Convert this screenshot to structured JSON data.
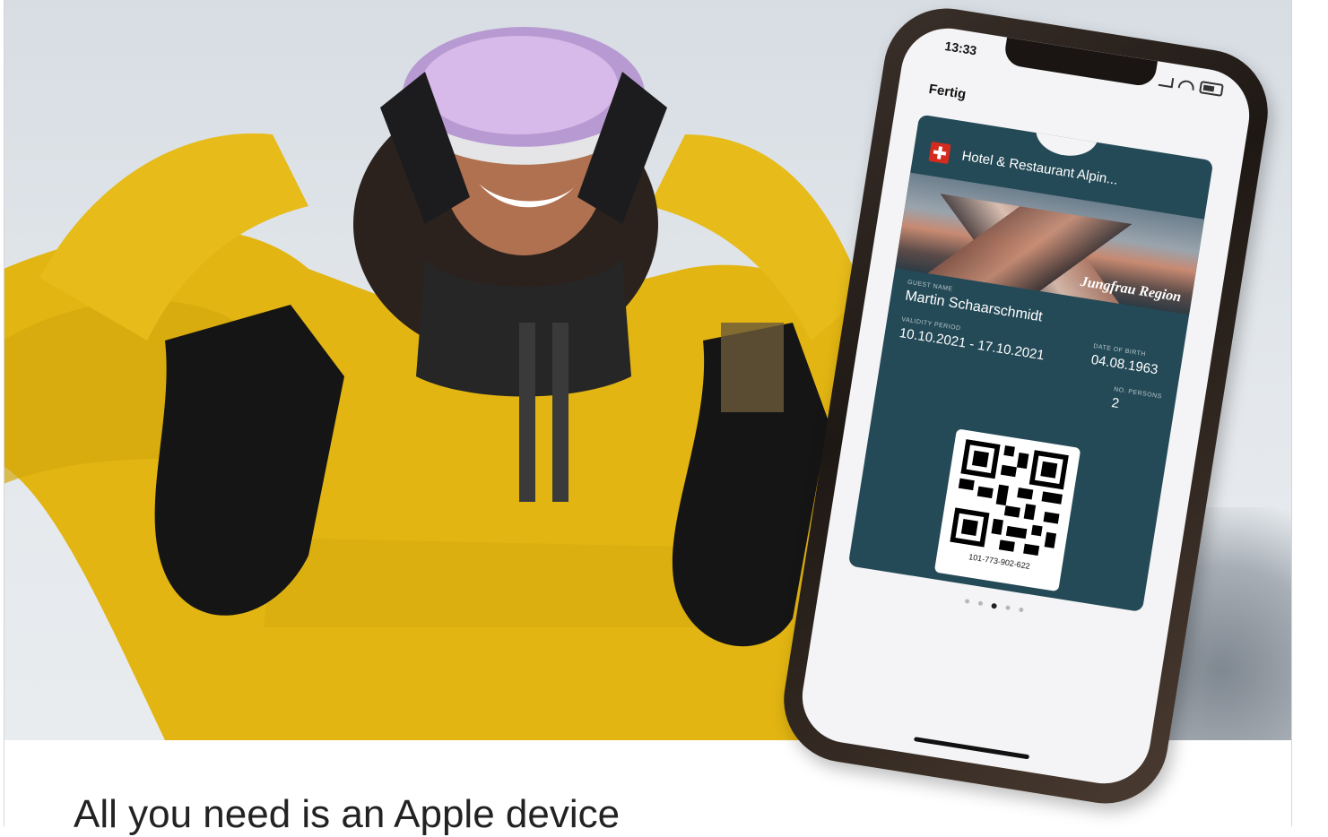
{
  "hero": {
    "image": "Woman in yellow ski jacket with goggles and black mittens, snowy background"
  },
  "phone": {
    "status_time": "13:33",
    "done_label": "Fertig",
    "pass": {
      "organization": "Hotel & Restaurant Alpin...",
      "banner_logo": "Jungfrau Region",
      "guest_name_label": "GUEST NAME",
      "guest_name": "Martin Schaarschmidt",
      "date_of_birth_label": "DATE OF BIRTH",
      "date_of_birth": "04.08.1963",
      "validity_label": "VALIDITY PERIOD",
      "validity": "10.10.2021 - 17.10.2021",
      "persons_label": "NO. PERSONS",
      "persons": "2",
      "qr_caption": "101-773-902-622"
    },
    "page_dots_count": 5,
    "page_dots_active": 3
  },
  "headline": "All you need is an Apple device",
  "colors": {
    "pass_background": "#244a57",
    "jacket": "#e2b512",
    "swiss_red": "#d52b1e"
  }
}
